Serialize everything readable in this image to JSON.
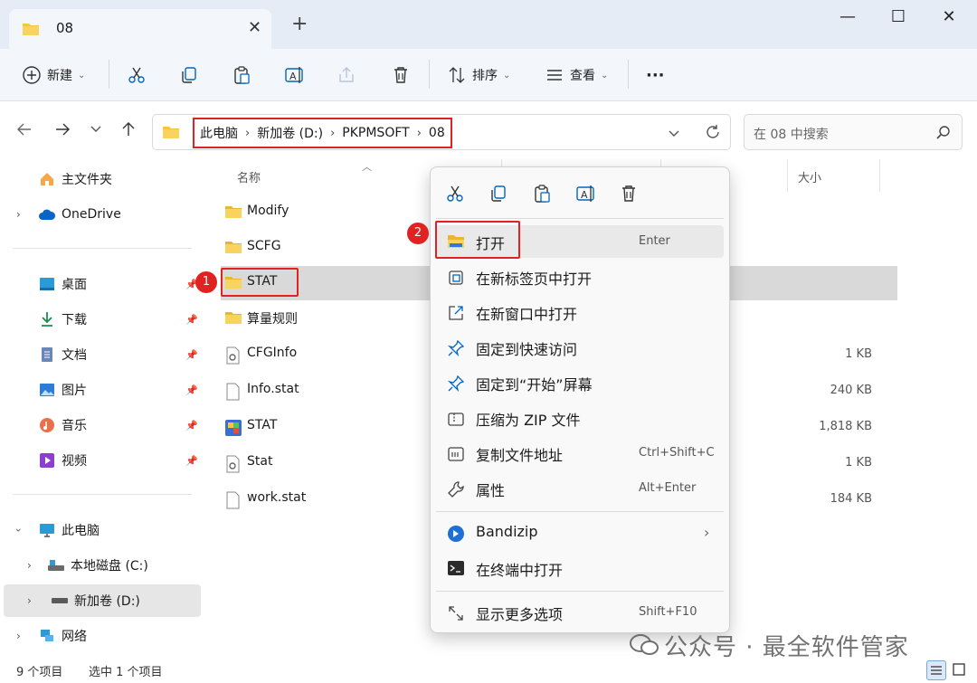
{
  "tab": {
    "title": "08",
    "close": "✕",
    "new": "+"
  },
  "window": {
    "minimize": "—",
    "maximize": "☐",
    "close": "✕"
  },
  "toolbar": {
    "new_label": "新建",
    "sort_label": "排序",
    "view_label": "查看",
    "more": "···"
  },
  "address": {
    "crumbs": [
      "此电脑",
      "新加卷 (D:)",
      "PKPMSOFT",
      "08"
    ],
    "sep": "›"
  },
  "search": {
    "placeholder": "在 08 中搜索"
  },
  "sidebar": {
    "home": "主文件夹",
    "onedrive": "OneDrive",
    "pinned": [
      "桌面",
      "下载",
      "文档",
      "图片",
      "音乐",
      "视频"
    ],
    "thispc": "此电脑",
    "drive_c": "本地磁盘 (C:)",
    "drive_d": "新加卷 (D:)",
    "network": "网络"
  },
  "columns": {
    "name": "名称",
    "size": "大小"
  },
  "files": [
    {
      "name": "Modify",
      "type": "folder",
      "size": ""
    },
    {
      "name": "SCFG",
      "type": "folder",
      "size": ""
    },
    {
      "name": "STAT",
      "type": "folder",
      "size": ""
    },
    {
      "name": "算量规则",
      "type": "folder",
      "size": ""
    },
    {
      "name": "CFGInfo",
      "type": "cfg",
      "size": "1 KB"
    },
    {
      "name": "Info.stat",
      "type": "file",
      "size": "240 KB"
    },
    {
      "name": "STAT",
      "type": "exe",
      "size": "1,818 KB"
    },
    {
      "name": "Stat",
      "type": "cfg",
      "size": "1 KB"
    },
    {
      "name": "work.stat",
      "type": "file",
      "size": "184 KB"
    }
  ],
  "annotations": {
    "badge1": "1",
    "badge2": "2"
  },
  "context_menu": {
    "items": [
      {
        "label": "打开",
        "key": "Enter"
      },
      {
        "label": "在新标签页中打开",
        "key": ""
      },
      {
        "label": "在新窗口中打开",
        "key": ""
      },
      {
        "label": "固定到快速访问",
        "key": ""
      },
      {
        "label": "固定到“开始”屏幕",
        "key": ""
      },
      {
        "label": "压缩为 ZIP 文件",
        "key": ""
      },
      {
        "label": "复制文件地址",
        "key": "Ctrl+Shift+C"
      },
      {
        "label": "属性",
        "key": "Alt+Enter"
      },
      {
        "label": "Bandizip",
        "key": ""
      },
      {
        "label": "在终端中打开",
        "key": ""
      },
      {
        "label": "显示更多选项",
        "key": "Shift+F10"
      }
    ]
  },
  "status": {
    "count": "9 个项目",
    "selected": "选中 1 个项目"
  },
  "watermark": "公众号 · 最全软件管家",
  "colors": {
    "highlight": "#e02222",
    "folder": "#f5c542",
    "accent": "#0067c0"
  }
}
